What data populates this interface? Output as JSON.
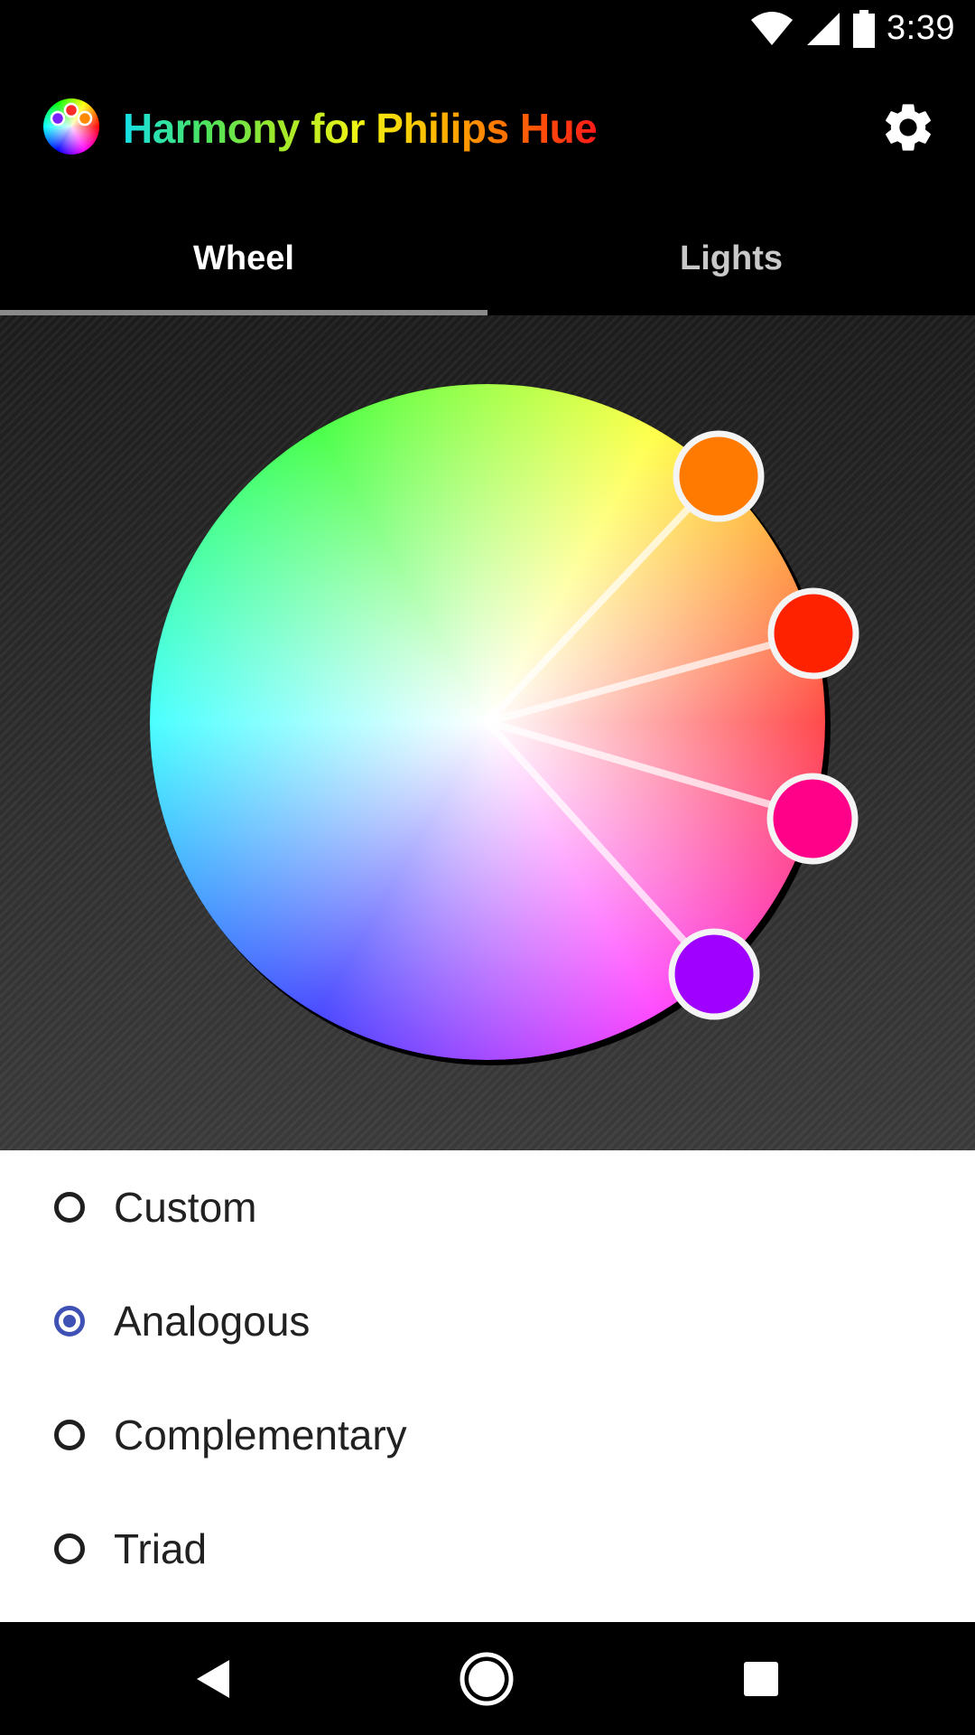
{
  "status_bar": {
    "time": "3:39",
    "icons": [
      "wifi-icon",
      "cell-signal-icon",
      "battery-icon"
    ]
  },
  "app_bar": {
    "title": "Harmony for Philips Hue",
    "logo_icon": "app-logo-icon",
    "settings_icon": "gear-icon"
  },
  "tabs": [
    {
      "label": "Wheel",
      "active": true
    },
    {
      "label": "Lights",
      "active": false
    }
  ],
  "color_wheel": {
    "selected_colors": [
      "#ff7a00",
      "#ff2200",
      "#ff0088",
      "#a000ff"
    ]
  },
  "harmony_options": [
    {
      "label": "Custom",
      "selected": false
    },
    {
      "label": "Analogous",
      "selected": true
    },
    {
      "label": "Complementary",
      "selected": false
    },
    {
      "label": "Triad",
      "selected": false
    }
  ],
  "nav_bar": {
    "icons": [
      "back-icon",
      "home-icon",
      "recents-icon"
    ]
  },
  "colors": {
    "accent": "#3f51b5",
    "background": "#000000"
  }
}
